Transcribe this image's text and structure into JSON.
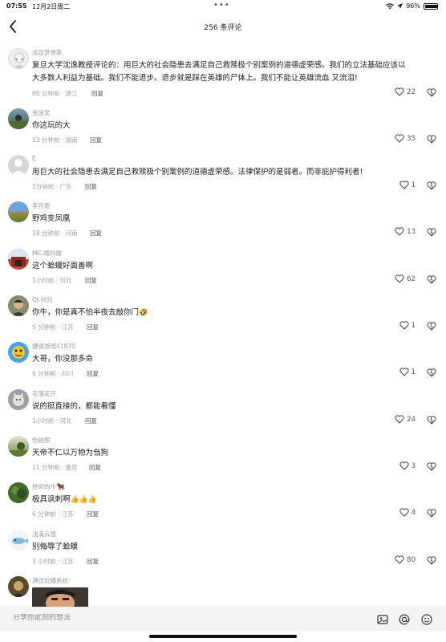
{
  "status_bar": {
    "time": "07:55",
    "date": "12月2日周二",
    "battery": "96%",
    "battery_level": 0.96
  },
  "header": {
    "title": "256 条评论"
  },
  "comments": [
    {
      "name": "淡定梦想家",
      "text": "复旦大学沈逸教授评论的：用巨大的社会隐患去满足自己救赎极个别案例的道德虚荣感。我们的立法基础应该以大多数人利益为基础。我们不能退步。退步就是踩在英雄的尸体上。我们不能让英雄流血 又流泪!",
      "time": "66 分钟前",
      "location": "浙江",
      "reply": "回复",
      "likes": "22"
    },
    {
      "name": "金泌文",
      "text": "你这玩的大",
      "time": "13 分钟前",
      "location": "湖南",
      "reply": "回复",
      "likes": "35"
    },
    {
      "name": "ξ",
      "text": "用巨大的社会隐患去满足自己救赎极个别案例的道德虚荣感。法律保护的是弱者。而非庇护得利者!",
      "time": "1分钟前",
      "location": "广东",
      "reply": "回复",
      "likes": "1"
    },
    {
      "name": "李开原",
      "text": "野鸡变凤凰",
      "time": "18 分钟前",
      "location": "河南",
      "reply": "回复",
      "likes": "13"
    },
    {
      "name": "MC.顺四福",
      "text": "这个蛤蟆好面善啊",
      "time": "1小时前",
      "location": "河北",
      "reply": "回复",
      "likes": "62"
    },
    {
      "name": "QJ.刘刘",
      "text": "你牛，你是真不怕半夜去敲你门",
      "emoji": "🤣",
      "time": "9 分钟前",
      "location": "江苏",
      "reply": "回复",
      "likes": "1"
    },
    {
      "name": "捷德游戏41870",
      "text": "大哥，你没那多命",
      "time": "6 分钟前",
      "location": "四川",
      "reply": "回复",
      "likes": "1"
    },
    {
      "name": "花落花开",
      "text": "说的挺直接的，都能看懂",
      "time": "1小时前",
      "location": "河北",
      "reply": "回复",
      "likes": "24"
    },
    {
      "name": "怡拍熊",
      "text": "天帝不仁以万物为刍狗",
      "time": "11 分钟前",
      "location": "重庆",
      "reply": "回复",
      "likes": "3"
    },
    {
      "name": "拼命的牛",
      "name_emoji": "🐂",
      "text": "极具讽刺啊",
      "emoji": "👍👍👍",
      "time": "6 分钟前",
      "location": "江苏",
      "reply": "回复",
      "likes": "4"
    },
    {
      "name": "浅溪云悠",
      "text": "别侮辱了蛤蟆",
      "time": "3 小时前",
      "location": "江苏",
      "reply": "回复",
      "likes": "80"
    },
    {
      "name": "满饮坑播系统"
    }
  ],
  "input_bar": {
    "placeholder": "分享你此刻的想法"
  },
  "icons": {
    "back": "chevron-left-icon",
    "like": "heart-icon",
    "dislike": "dislike-icon",
    "image": "image-icon",
    "mention": "at-icon",
    "emoji": "smiley-icon"
  }
}
